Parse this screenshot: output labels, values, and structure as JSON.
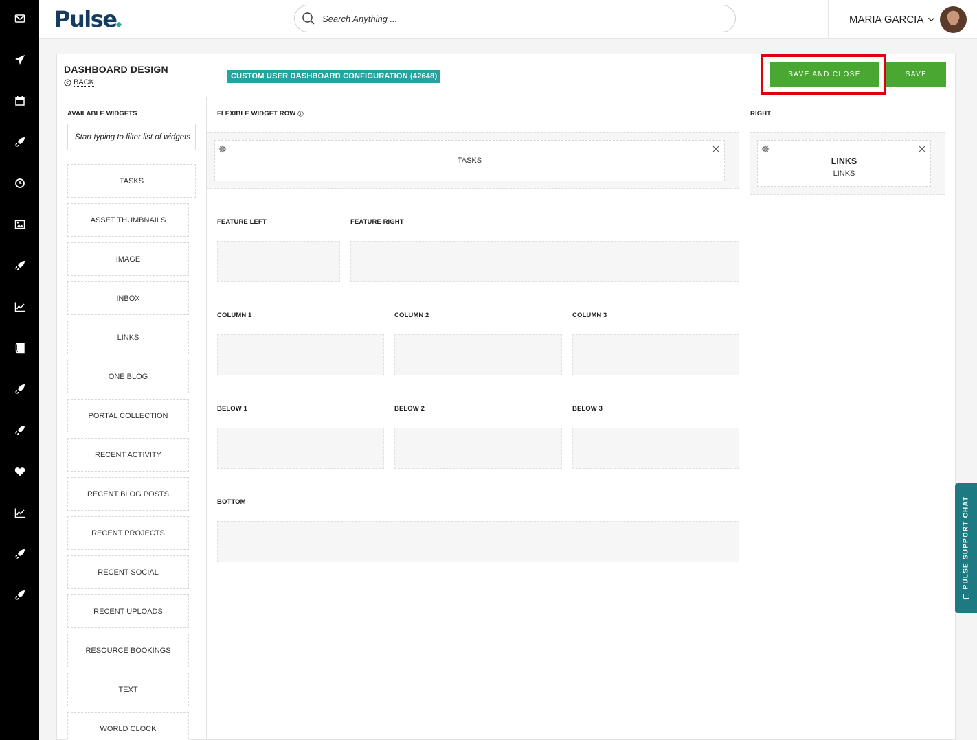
{
  "app": {
    "logo": "Pulse"
  },
  "rail": {
    "icons": [
      "mail-icon",
      "send-icon",
      "calendar-icon",
      "rocket-icon",
      "clock-icon",
      "image-icon",
      "rocket-icon",
      "chart-icon",
      "book-icon",
      "rocket-icon",
      "rocket-icon",
      "heart-icon",
      "chart-icon",
      "rocket-icon",
      "rocket-icon"
    ]
  },
  "header": {
    "search_placeholder": "Search Anything ...",
    "user_name": "MARIA GARCIA"
  },
  "page": {
    "title": "DASHBOARD DESIGN",
    "back_label": "BACK",
    "config_badge": "CUSTOM USER DASHBOARD CONFIGURATION (42648)",
    "save_close_label": "SAVE AND CLOSE",
    "save_label": "SAVE"
  },
  "widgets": {
    "heading": "AVAILABLE WIDGETS",
    "filter_placeholder": "Start typing to filter list of widgets",
    "items": [
      "TASKS",
      "ASSET THUMBNAILS",
      "IMAGE",
      "INBOX",
      "LINKS",
      "ONE BLOG",
      "PORTAL COLLECTION",
      "RECENT ACTIVITY",
      "RECENT BLOG POSTS",
      "RECENT PROJECTS",
      "RECENT SOCIAL",
      "RECENT UPLOADS",
      "RESOURCE BOOKINGS",
      "TEXT",
      "WORLD CLOCK"
    ]
  },
  "layout": {
    "flexible_row": {
      "label": "FLEXIBLE WIDGET ROW",
      "widget": "TASKS"
    },
    "right": {
      "label": "RIGHT",
      "widget_title": "LINKS",
      "widget_subtitle": "LINKS"
    },
    "feature_left": "FEATURE LEFT",
    "feature_right": "FEATURE RIGHT",
    "column_1": "COLUMN 1",
    "column_2": "COLUMN 2",
    "column_3": "COLUMN 3",
    "below_1": "BELOW 1",
    "below_2": "BELOW 2",
    "below_3": "BELOW 3",
    "bottom": "BOTTOM"
  },
  "support": {
    "label": "PULSE SUPPORT CHAT"
  }
}
